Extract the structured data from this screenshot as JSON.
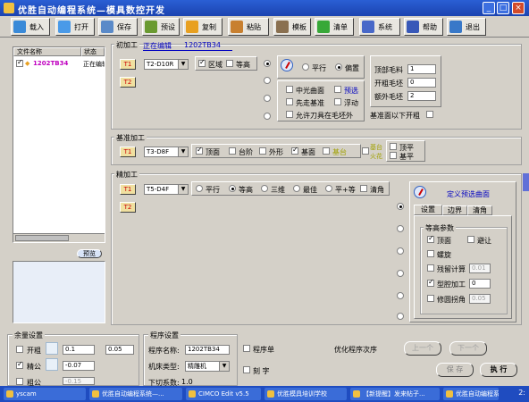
{
  "window": {
    "title": "优胜自动编程系统—模具数控开发",
    "btn_min": "_",
    "btn_max": "□",
    "btn_close": "×"
  },
  "toolbar": [
    {
      "label": "载入",
      "color": "#3a8ad8"
    },
    {
      "label": "打开",
      "color": "#4a9ae8"
    },
    {
      "label": "保存",
      "color": "#5a8ac8"
    },
    {
      "label": "预设",
      "color": "#6a9a30"
    },
    {
      "label": "复制",
      "color": "#e8a020"
    },
    {
      "label": "粘贴",
      "color": "#c88030"
    },
    {
      "label": "模板",
      "color": "#8a7050"
    },
    {
      "label": "清单",
      "color": "#38a838"
    },
    {
      "label": "系统",
      "color": "#4868c8"
    },
    {
      "label": "帮助",
      "color": "#3858b8"
    },
    {
      "label": "退出",
      "color": "#3878c8"
    }
  ],
  "filelist": {
    "col_name": "文件名称",
    "col_status": "状态",
    "rows": [
      {
        "name": "1202TB34",
        "status": "正在编辑"
      }
    ],
    "preview_btn": "预览"
  },
  "rough": {
    "title": "初加工",
    "editing_label": "正在编辑",
    "editing_name": "1202TB34",
    "tool": "T2-D10R",
    "opt_area": "区域",
    "opt_contour": "等高",
    "dir_parallel": "平行",
    "dir_offset": "偏置",
    "opt_center": "中光曲面",
    "opt_preselect": "预选",
    "opt_base_first": "先走基准",
    "opt_float": "浮动",
    "opt_allow_tool": "允许刀具在毛坯外",
    "top_stock_label": "顶部毛料",
    "top_stock": "1",
    "side_stock_label": "开粗毛坯",
    "side_stock": "0",
    "extra_label": "额外毛坯",
    "extra": "2",
    "below_base": "基准面以下开粗"
  },
  "datum": {
    "title": "基准加工",
    "tool": "T3-D8F",
    "opt_top": "顶面",
    "opt_step": "台阶",
    "opt_outline": "外形",
    "opt_base": "基面",
    "opt_platform": "基台",
    "opt_platform2": "基台",
    "opt_fire": "火花",
    "opt_top_flat": "顶平",
    "opt_base_flat": "基平"
  },
  "finish": {
    "title": "精加工",
    "tool": "T5-D4F",
    "m_parallel": "平行",
    "m_contour": "等高",
    "m_3d": "三维",
    "m_best": "最佳",
    "m_parallel_contour": "平+等",
    "m_corner": "清角",
    "define_surface": "定义预选曲面",
    "tabs": [
      "设置",
      "边界",
      "清角"
    ],
    "contour_params": "等高参数",
    "p_top": "顶面",
    "p_avoid": "避让",
    "p_spiral": "螺旋",
    "p_residual": "残留计算",
    "p_residual_val": "0.01",
    "p_profile": "型腔加工",
    "p_profile_val": "0",
    "p_fillet": "修圆拐角",
    "p_fillet_val": "0.05"
  },
  "allowance": {
    "title": "余量设置",
    "rough_label": "开粗",
    "rough_val": "0.1",
    "rough_val2": "0.05",
    "semi_label": "精公",
    "semi_val": "-0.07",
    "fine_label": "粗公",
    "fine_val": "-0.15"
  },
  "program": {
    "title": "程序设置",
    "name_label": "程序名称:",
    "name_val": "1202TB34",
    "machine_label": "机床类型:",
    "machine_val": "精雕机",
    "cut_label": "下切系数:",
    "cut_val": "1.0",
    "prog_list": "程序单",
    "engrave": "刻 字",
    "optimize": "优化程序次序",
    "prev": "上一个",
    "next": "下一个",
    "save": "保 存",
    "exec": "执 行"
  },
  "taskbar": {
    "items": [
      "yscam",
      "优胜自动编程系统—...",
      "CIMCO Edit v5.5",
      "优胜模具培训学校",
      "【新提醒】发来帖子...",
      "优胜自动编程系统..."
    ],
    "time": "2:"
  }
}
